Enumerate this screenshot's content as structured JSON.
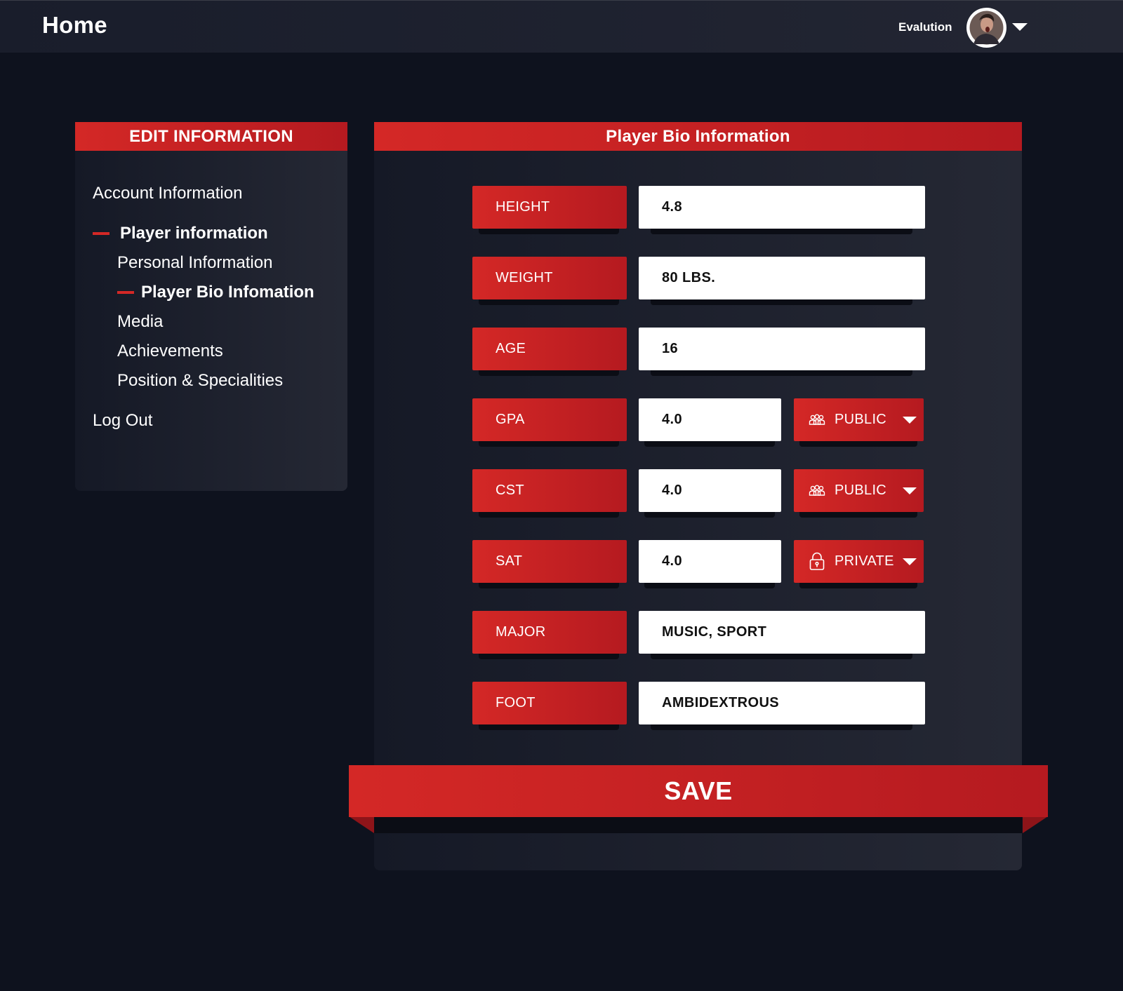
{
  "topbar": {
    "title": "Home",
    "user_name": "Evalution",
    "avatar_icon": "user-avatar",
    "menu_icon": "chevron-down-icon"
  },
  "sidebar": {
    "header": "EDIT INFORMATION",
    "account": "Account Information",
    "player_info": "Player information",
    "sub_items": {
      "personal": "Personal Information",
      "bio": "Player Bio Infomation",
      "media": "Media",
      "achievements": "Achievements",
      "positions": "Position & Specialities"
    },
    "logout": "Log Out"
  },
  "main": {
    "header": "Player Bio Information",
    "fields": {
      "height": {
        "label": "HEIGHT",
        "value": "4.8"
      },
      "weight": {
        "label": "WEIGHT",
        "value": "80 LBS."
      },
      "age": {
        "label": "AGE",
        "value": "16"
      },
      "gpa": {
        "label": "GPA",
        "value": "4.0",
        "privacy": "PUBLIC",
        "privacy_icon": "group-icon"
      },
      "cst": {
        "label": "CST",
        "value": "4.0",
        "privacy": "PUBLIC",
        "privacy_icon": "group-icon"
      },
      "sat": {
        "label": "SAT",
        "value": "4.0",
        "privacy": "PRIVATE",
        "privacy_icon": "lock-icon"
      },
      "major": {
        "label": "MAJOR",
        "value": "MUSIC, SPORT"
      },
      "foot": {
        "label": "FOOT",
        "value": "AMBIDEXTROUS"
      }
    },
    "save_label": "SAVE"
  },
  "colors": {
    "accent": "#d42826",
    "accent_dark": "#b51a20",
    "background": "#0e121e",
    "panel": "#232633"
  }
}
